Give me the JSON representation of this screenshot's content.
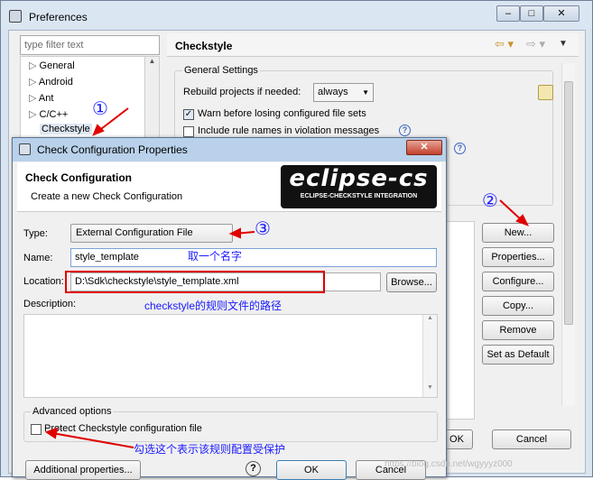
{
  "pref": {
    "title": "Preferences",
    "filter_placeholder": "type filter text",
    "tree": [
      "General",
      "Android",
      "Ant",
      "C/C++",
      "Checkstyle"
    ],
    "page_title": "Checkstyle",
    "group_general": "General Settings",
    "rebuild_label": "Rebuild projects if needed:",
    "rebuild_value": "always",
    "warn_label": "Warn before losing configured file sets",
    "include_label": "Include rule names in violation messages",
    "help": "?",
    "buttons": {
      "new": "New...",
      "properties": "Properties...",
      "configure": "Configure...",
      "copy": "Copy...",
      "remove": "Remove",
      "default": "Set as Default",
      "ok": "OK",
      "cancel": "Cancel"
    },
    "win_controls": [
      "–",
      "□",
      "✕"
    ]
  },
  "dialog": {
    "title": "Check Configuration Properties",
    "header": "Check Configuration",
    "subtitle": "Create a new Check Configuration",
    "logo_main": "eclipse-cs",
    "logo_sub": "ECLIPSE-CHECKSTYLE INTEGRATION",
    "type_label": "Type:",
    "type_value": "External Configuration File",
    "name_label": "Name:",
    "name_value": "style_template",
    "location_label": "Location:",
    "location_value": "D:\\Sdk\\checkstyle\\style_template.xml",
    "browse": "Browse...",
    "description_label": "Description:",
    "advanced_label": "Advanced options",
    "protect_label": "Protect Checkstyle configuration file",
    "additional": "Additional properties...",
    "ok": "OK",
    "cancel": "Cancel",
    "help": "?",
    "close": "✕"
  },
  "annotations": {
    "n1": "①",
    "n2": "②",
    "n3": "③",
    "name_note": "取一个名字",
    "location_note": "checkstyle的规则文件的路径",
    "protect_note": "勾选这个表示该规则配置受保护",
    "watermark": "https://blog.csdn.net/wgyyyz000"
  },
  "colors": {
    "annotation_red": "#e00000",
    "annotation_blue": "#1a1aff",
    "dialog_title_bar": "#b9d1ea"
  }
}
